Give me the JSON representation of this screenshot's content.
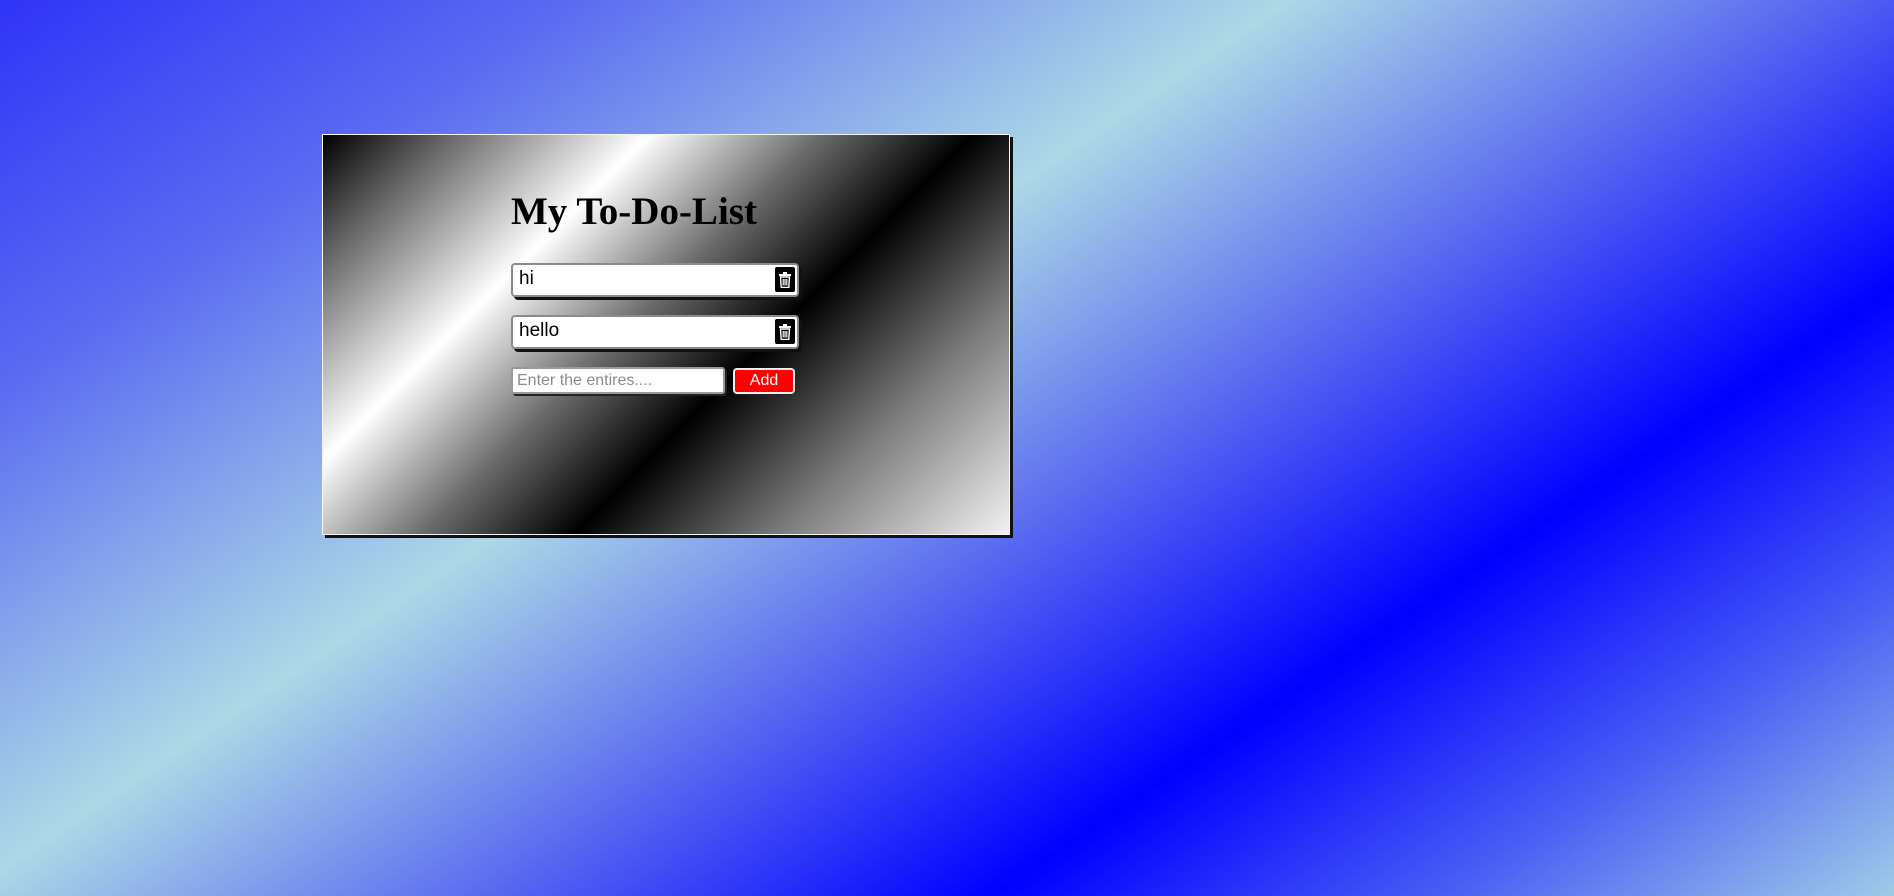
{
  "page": {
    "title": "My To-Do-List"
  },
  "todos": [
    {
      "text": "hi",
      "delete_icon": "trash-icon"
    },
    {
      "text": "hello",
      "delete_icon": "trash-icon"
    }
  ],
  "entry": {
    "placeholder": "Enter the entires....",
    "value": "",
    "add_label": "Add"
  },
  "colors": {
    "add_button": "#ff0000",
    "delete_button": "#000000",
    "background_accent": "#0000ff"
  }
}
